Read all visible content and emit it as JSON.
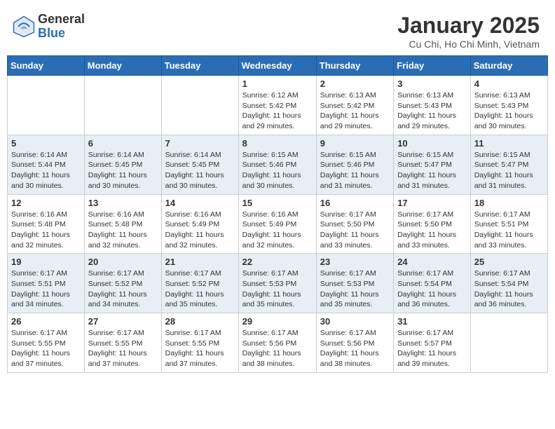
{
  "header": {
    "logo_general": "General",
    "logo_blue": "Blue",
    "month_title": "January 2025",
    "location": "Cu Chi, Ho Chi Minh, Vietnam"
  },
  "weekdays": [
    "Sunday",
    "Monday",
    "Tuesday",
    "Wednesday",
    "Thursday",
    "Friday",
    "Saturday"
  ],
  "weeks": [
    [
      {
        "day": "",
        "info": ""
      },
      {
        "day": "",
        "info": ""
      },
      {
        "day": "",
        "info": ""
      },
      {
        "day": "1",
        "info": "Sunrise: 6:12 AM\nSunset: 5:42 PM\nDaylight: 11 hours\nand 29 minutes."
      },
      {
        "day": "2",
        "info": "Sunrise: 6:13 AM\nSunset: 5:42 PM\nDaylight: 11 hours\nand 29 minutes."
      },
      {
        "day": "3",
        "info": "Sunrise: 6:13 AM\nSunset: 5:43 PM\nDaylight: 11 hours\nand 29 minutes."
      },
      {
        "day": "4",
        "info": "Sunrise: 6:13 AM\nSunset: 5:43 PM\nDaylight: 11 hours\nand 30 minutes."
      }
    ],
    [
      {
        "day": "5",
        "info": "Sunrise: 6:14 AM\nSunset: 5:44 PM\nDaylight: 11 hours\nand 30 minutes."
      },
      {
        "day": "6",
        "info": "Sunrise: 6:14 AM\nSunset: 5:45 PM\nDaylight: 11 hours\nand 30 minutes."
      },
      {
        "day": "7",
        "info": "Sunrise: 6:14 AM\nSunset: 5:45 PM\nDaylight: 11 hours\nand 30 minutes."
      },
      {
        "day": "8",
        "info": "Sunrise: 6:15 AM\nSunset: 5:46 PM\nDaylight: 11 hours\nand 30 minutes."
      },
      {
        "day": "9",
        "info": "Sunrise: 6:15 AM\nSunset: 5:46 PM\nDaylight: 11 hours\nand 31 minutes."
      },
      {
        "day": "10",
        "info": "Sunrise: 6:15 AM\nSunset: 5:47 PM\nDaylight: 11 hours\nand 31 minutes."
      },
      {
        "day": "11",
        "info": "Sunrise: 6:15 AM\nSunset: 5:47 PM\nDaylight: 11 hours\nand 31 minutes."
      }
    ],
    [
      {
        "day": "12",
        "info": "Sunrise: 6:16 AM\nSunset: 5:48 PM\nDaylight: 11 hours\nand 32 minutes."
      },
      {
        "day": "13",
        "info": "Sunrise: 6:16 AM\nSunset: 5:48 PM\nDaylight: 11 hours\nand 32 minutes."
      },
      {
        "day": "14",
        "info": "Sunrise: 6:16 AM\nSunset: 5:49 PM\nDaylight: 11 hours\nand 32 minutes."
      },
      {
        "day": "15",
        "info": "Sunrise: 6:16 AM\nSunset: 5:49 PM\nDaylight: 11 hours\nand 32 minutes."
      },
      {
        "day": "16",
        "info": "Sunrise: 6:17 AM\nSunset: 5:50 PM\nDaylight: 11 hours\nand 33 minutes."
      },
      {
        "day": "17",
        "info": "Sunrise: 6:17 AM\nSunset: 5:50 PM\nDaylight: 11 hours\nand 33 minutes."
      },
      {
        "day": "18",
        "info": "Sunrise: 6:17 AM\nSunset: 5:51 PM\nDaylight: 11 hours\nand 33 minutes."
      }
    ],
    [
      {
        "day": "19",
        "info": "Sunrise: 6:17 AM\nSunset: 5:51 PM\nDaylight: 11 hours\nand 34 minutes."
      },
      {
        "day": "20",
        "info": "Sunrise: 6:17 AM\nSunset: 5:52 PM\nDaylight: 11 hours\nand 34 minutes."
      },
      {
        "day": "21",
        "info": "Sunrise: 6:17 AM\nSunset: 5:52 PM\nDaylight: 11 hours\nand 35 minutes."
      },
      {
        "day": "22",
        "info": "Sunrise: 6:17 AM\nSunset: 5:53 PM\nDaylight: 11 hours\nand 35 minutes."
      },
      {
        "day": "23",
        "info": "Sunrise: 6:17 AM\nSunset: 5:53 PM\nDaylight: 11 hours\nand 35 minutes."
      },
      {
        "day": "24",
        "info": "Sunrise: 6:17 AM\nSunset: 5:54 PM\nDaylight: 11 hours\nand 36 minutes."
      },
      {
        "day": "25",
        "info": "Sunrise: 6:17 AM\nSunset: 5:54 PM\nDaylight: 11 hours\nand 36 minutes."
      }
    ],
    [
      {
        "day": "26",
        "info": "Sunrise: 6:17 AM\nSunset: 5:55 PM\nDaylight: 11 hours\nand 37 minutes."
      },
      {
        "day": "27",
        "info": "Sunrise: 6:17 AM\nSunset: 5:55 PM\nDaylight: 11 hours\nand 37 minutes."
      },
      {
        "day": "28",
        "info": "Sunrise: 6:17 AM\nSunset: 5:55 PM\nDaylight: 11 hours\nand 37 minutes."
      },
      {
        "day": "29",
        "info": "Sunrise: 6:17 AM\nSunset: 5:56 PM\nDaylight: 11 hours\nand 38 minutes."
      },
      {
        "day": "30",
        "info": "Sunrise: 6:17 AM\nSunset: 5:56 PM\nDaylight: 11 hours\nand 38 minutes."
      },
      {
        "day": "31",
        "info": "Sunrise: 6:17 AM\nSunset: 5:57 PM\nDaylight: 11 hours\nand 39 minutes."
      },
      {
        "day": "",
        "info": ""
      }
    ]
  ]
}
